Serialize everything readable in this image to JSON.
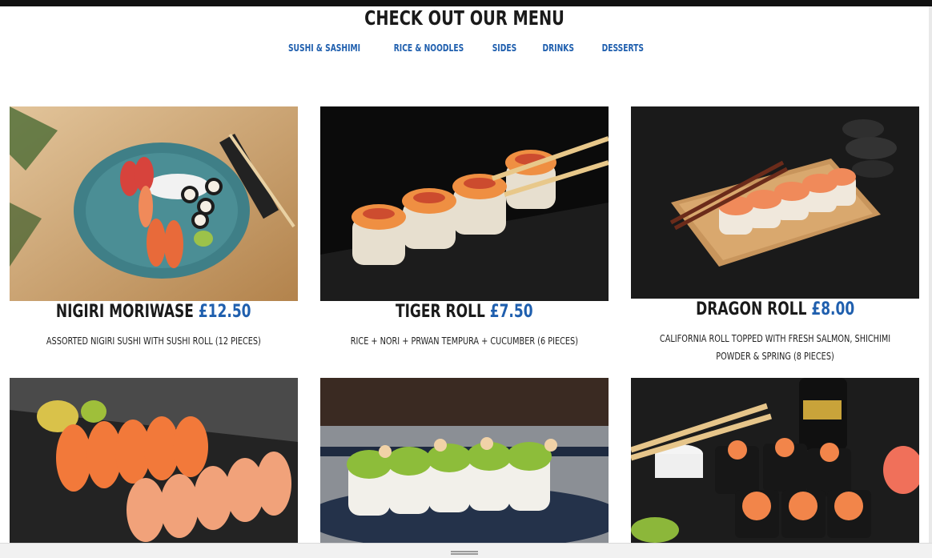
{
  "menu": {
    "heading": "Check out our menu",
    "categories": [
      "Sushi & Sashimi",
      "Rice & Noodles",
      "Sides",
      "Drinks",
      "Desserts"
    ],
    "items": [
      {
        "name": "Nigiri Moriwase",
        "price": "£12.50",
        "description": "Assorted nigiri sushi with sushi roll (12 pieces)"
      },
      {
        "name": "Tiger Roll",
        "price": "£7.50",
        "description": "Rice + nori + prwan tempura + cucumber (6 pieces)"
      },
      {
        "name": "Dragon Roll",
        "price": "£8.00",
        "description": "California roll topped with fresh salmon, shichimi powder & spring (8 pieces)"
      }
    ]
  },
  "colors": {
    "accent": "#1f5fae",
    "text": "#1a1a1a",
    "topbar": "#111111"
  }
}
